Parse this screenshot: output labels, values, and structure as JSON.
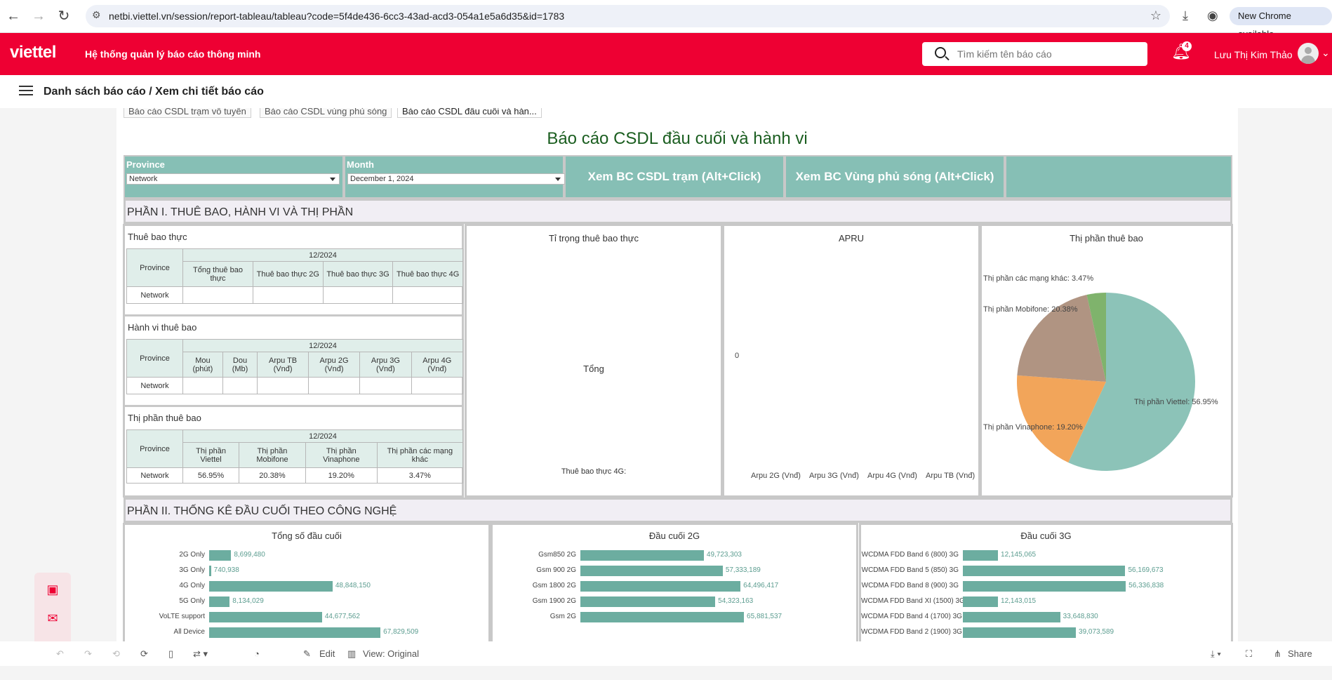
{
  "browser": {
    "url": "netbi.viettel.vn/session/report-tableau/tableau?code=5f4de436-6cc3-43ad-acd3-054a1e5a6d35&id=1783",
    "new_chrome_label": "New Chrome available"
  },
  "header": {
    "logo": "viettel",
    "system_title": "Hệ thống quản lý báo cáo thông minh",
    "search_placeholder": "Tìm kiếm tên báo cáo",
    "notification_count": "4",
    "user_name": "Lưu Thị Kim Thảo"
  },
  "breadcrumb": "Danh sách báo cáo / Xem chi tiết báo cáo",
  "tabs": [
    "Báo cáo CSDL trạm vô tuyến",
    "Báo cáo CSDL vùng phủ sóng",
    "Báo cáo CSDL đầu cuối và hàn..."
  ],
  "dashboard": {
    "title": "Báo cáo CSDL đầu cuối và hành vi",
    "filters": {
      "province_label": "Province",
      "province_value": "Network",
      "month_label": "Month",
      "month_value": "December 1, 2024"
    },
    "buttons": {
      "csdl_tram": "Xem BC CSDL trạm (Alt+Click)",
      "vung_phu_song": "Xem BC Vùng phủ sóng (Alt+Click)"
    },
    "section1": "PHẦN I. THUÊ BAO, HÀNH VI VÀ THỊ PHẦN",
    "section2": "PHẦN II. THỐNG KÊ ĐẦU CUỐI THEO CÔNG NGHỆ",
    "table1": {
      "title": "Thuê bao thực",
      "period": "12/2024",
      "columns": [
        "Province",
        "Tổng thuê bao thực",
        "Thuê bao thực 2G",
        "Thuê bao thực 3G",
        "Thuê bao thực 4G"
      ],
      "rows": [
        [
          "Network",
          "",
          "",
          "",
          ""
        ]
      ]
    },
    "table2": {
      "title": "Hành vi thuê bao",
      "period": "12/2024",
      "columns": [
        "Province",
        "Mou (phút)",
        "Dou (Mb)",
        "Arpu TB (Vnđ)",
        "Arpu 2G (Vnđ)",
        "Arpu 3G (Vnđ)",
        "Arpu 4G (Vnđ)"
      ],
      "rows": [
        [
          "Network",
          "",
          "",
          "",
          "",
          "",
          ""
        ]
      ]
    },
    "table3": {
      "title": "Thị phần thuê bao",
      "period": "12/2024",
      "columns": [
        "Province",
        "Thị phần Viettel",
        "Thị phần Mobifone",
        "Thị phần Vinaphone",
        "Thị phần các mạng khác"
      ],
      "rows": [
        [
          "Network",
          "56.95%",
          "20.38%",
          "19.20%",
          "3.47%"
        ]
      ]
    },
    "ti_trong": {
      "title": "Tỉ trọng thuê bao thực",
      "center_label": "Tổng",
      "bottom_label": "Thuê bao thực 4G:"
    },
    "apru": {
      "title": "APRU",
      "zero_label": "0",
      "x_labels": [
        "Arpu 2G (Vnđ)",
        "Arpu 3G (Vnđ)",
        "Arpu 4G (Vnđ)",
        "Arpu TB (Vnđ)"
      ]
    }
  },
  "chart_data": [
    {
      "type": "pie",
      "title": "Thị phần thuê bao",
      "slices": [
        {
          "label": "Thị phần Viettel",
          "value": 56.95,
          "color": "#8cc3b8"
        },
        {
          "label": "Thị phần Vinaphone",
          "value": 19.2,
          "color": "#f2a55a"
        },
        {
          "label": "Thị phần Mobifone",
          "value": 20.38,
          "color": "#b09482"
        },
        {
          "label": "Thị phần các mạng khác",
          "value": 3.47,
          "color": "#7fb36c"
        }
      ]
    },
    {
      "type": "bar",
      "title": "Tổng số đầu cuối",
      "categories": [
        "2G Only",
        "3G Only",
        "4G Only",
        "5G Only",
        "VoLTE support",
        "All Device"
      ],
      "values": [
        8699480,
        740938,
        48848150,
        8134029,
        44677562,
        67829509
      ],
      "labels": [
        "8,699,480",
        "740,938",
        "48,848,150",
        "8,134,029",
        "44,677,562",
        "67,829,509"
      ]
    },
    {
      "type": "bar",
      "title": "Đầu cuối 2G",
      "categories": [
        "Gsm850 2G",
        "Gsm 900 2G",
        "Gsm 1800 2G",
        "Gsm 1900 2G",
        "Gsm 2G"
      ],
      "values": [
        49723303,
        57333189,
        64496417,
        54323163,
        65881537
      ],
      "labels": [
        "49,723,303",
        "57,333,189",
        "64,496,417",
        "54,323,163",
        "65,881,537"
      ]
    },
    {
      "type": "bar",
      "title": "Đầu cuối 3G",
      "categories": [
        "WCDMA FDD Band 6 (800) 3G",
        "WCDMA FDD Band 5 (850) 3G",
        "WCDMA FDD Band 8 (900) 3G",
        "WCDMA FDD Band XI (1500) 3G",
        "WCDMA FDD Band 4 (1700) 3G",
        "WCDMA FDD Band 2 (1900) 3G"
      ],
      "values": [
        12145065,
        56169673,
        56336838,
        12143015,
        33648830,
        39073589
      ],
      "labels": [
        "12,145,065",
        "56,169,673",
        "56,336,838",
        "12,143,015",
        "33,648,830",
        "39,073,589"
      ]
    }
  ],
  "toolbar": {
    "edit": "Edit",
    "view": "View: Original",
    "share": "Share"
  }
}
